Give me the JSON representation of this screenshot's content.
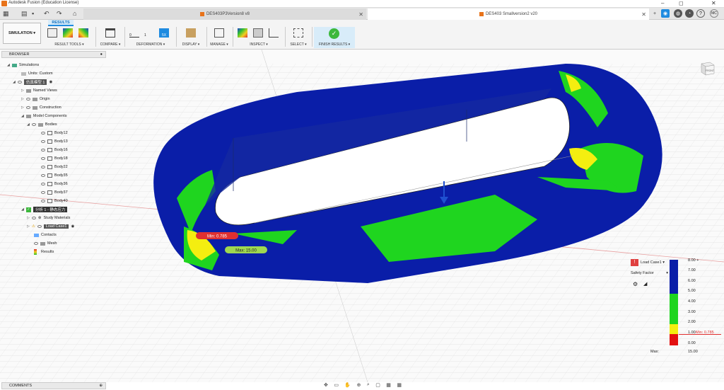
{
  "window": {
    "title": "Autodesk Fusion (Education License)",
    "min": "–",
    "max": "◻",
    "close": "✕"
  },
  "tabs": [
    {
      "label": "DES403P3Version8 v8",
      "close": "✕"
    },
    {
      "label": "DES403 Smallversion2 v20",
      "close": "✕"
    }
  ],
  "tabbar": {
    "add": "+",
    "user": "MC",
    "help": "?"
  },
  "toolbar": {
    "workspace": "SIMULATION ▾",
    "active_tab": "RESULTS",
    "groups": [
      "RESULT TOOLS ▾",
      "COMPARE ▾",
      "DEFORMATION ▾",
      "DISPLAY ▾",
      "MANAGE ▾",
      "INSPECT ▾",
      "SELECT ▾",
      "FINISH RESULTS ▾"
    ],
    "deform_values": [
      "0",
      "1",
      "5X"
    ]
  },
  "browser": {
    "title": "BROWSER",
    "items": [
      {
        "label": "Simulations"
      },
      {
        "label": "Units: Custom"
      },
      {
        "label": "仿真模型 1"
      },
      {
        "label": "Named Views"
      },
      {
        "label": "Origin"
      },
      {
        "label": "Construction"
      },
      {
        "label": "Model Components"
      },
      {
        "label": "Bodies"
      },
      {
        "label": "Body12"
      },
      {
        "label": "Body13"
      },
      {
        "label": "Body16"
      },
      {
        "label": "Body18"
      },
      {
        "label": "Body22"
      },
      {
        "label": "Body35"
      },
      {
        "label": "Body36"
      },
      {
        "label": "Body37"
      },
      {
        "label": "Body40"
      },
      {
        "label": "分析 1 - 静态应力"
      },
      {
        "label": "Study Materials"
      },
      {
        "label": "Load Case1"
      },
      {
        "label": "Contacts"
      },
      {
        "label": "Mesh"
      },
      {
        "label": "Results"
      }
    ]
  },
  "probes": {
    "min": "Min: 0.785",
    "max": "Max: 15.00"
  },
  "legend": {
    "load_case": "Load Case1 ▾",
    "warning": "!",
    "result_type": "Safety Factor",
    "ticks": [
      "8.00 +",
      "7.00",
      "6.00",
      "5.00",
      "4.00",
      "3.00",
      "2.00",
      "1.00",
      "0.00"
    ],
    "min_label": "Min: 0.785",
    "max_label": "Max:",
    "max_value": "15.00",
    "colors": [
      "#0a1ea8",
      "#1fd51f",
      "#f4ee10",
      "#e31010"
    ]
  },
  "viewcube": {
    "label": "FRONT"
  },
  "comments": {
    "title": "COMMENTS"
  },
  "navbar": {
    "icons": [
      "✥",
      "▭",
      "✋",
      "⊕",
      "⌕",
      "▢",
      "▦",
      "▦"
    ]
  }
}
